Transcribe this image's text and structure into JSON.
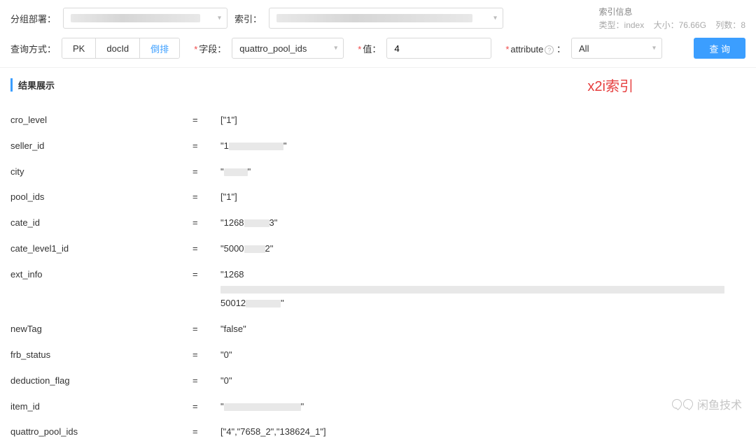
{
  "topRow": {
    "groupLabel": "分组部署：",
    "groupValue": "",
    "indexLabel": "索引：",
    "indexValue": "",
    "meta": {
      "title": "索引信息",
      "typeLabel": "类型：",
      "typeValue": "index",
      "sizeLabel": "大小：",
      "sizeValue": "76.66G",
      "colLabel": "列数：",
      "colValue": "8"
    }
  },
  "row2": {
    "queryModeLabel": "查询方式：",
    "seg": [
      "PK",
      "docId",
      "倒排"
    ],
    "segActive": 2,
    "fieldLabel": "字段：",
    "fieldValue": "quattro_pool_ids",
    "valueLabel": "值：",
    "valueValue": "4",
    "attrLabel": "attribute",
    "attrValue": "All",
    "queryBtn": "查 询"
  },
  "section": {
    "title": "结果展示",
    "badge": "x2i索引"
  },
  "results": [
    {
      "key": "cro_level",
      "val": "[\"1\"]",
      "prefix": "",
      "blurW": 0
    },
    {
      "key": "seller_id",
      "val": "",
      "prefix": "\"1",
      "blurW": 78,
      "suffix": "\""
    },
    {
      "key": "city",
      "val": "",
      "prefix": "\"",
      "blurW": 34,
      "suffix": "\""
    },
    {
      "key": "pool_ids",
      "val": "[\"1\"]",
      "prefix": "",
      "blurW": 0
    },
    {
      "key": "cate_id",
      "val": "",
      "prefix": "\"1268",
      "blurW": 36,
      "suffix": "3\""
    },
    {
      "key": "cate_level1_id",
      "val": "",
      "prefix": "\"5000",
      "blurW": 30,
      "suffix": "2\""
    },
    {
      "key": "ext_info",
      "val": "",
      "prefix": "\"1268",
      "blurW": 720,
      "line2prefix": "50012",
      "line2blurW": 50,
      "line2suffix": "\""
    },
    {
      "key": "newTag",
      "val": "\"false\"",
      "prefix": "",
      "blurW": 0
    },
    {
      "key": "frb_status",
      "val": "\"0\"",
      "prefix": "",
      "blurW": 0
    },
    {
      "key": "deduction_flag",
      "val": "\"0\"",
      "prefix": "",
      "blurW": 0
    },
    {
      "key": "item_id",
      "val": "",
      "prefix": "\"",
      "blurW": 110,
      "suffix": "\""
    },
    {
      "key": "quattro_pool_ids",
      "val": "[\"4\",\"7658_2\",\"138624_1\"]",
      "prefix": "",
      "blurW": 0
    }
  ],
  "watermark": "闲鱼技术"
}
